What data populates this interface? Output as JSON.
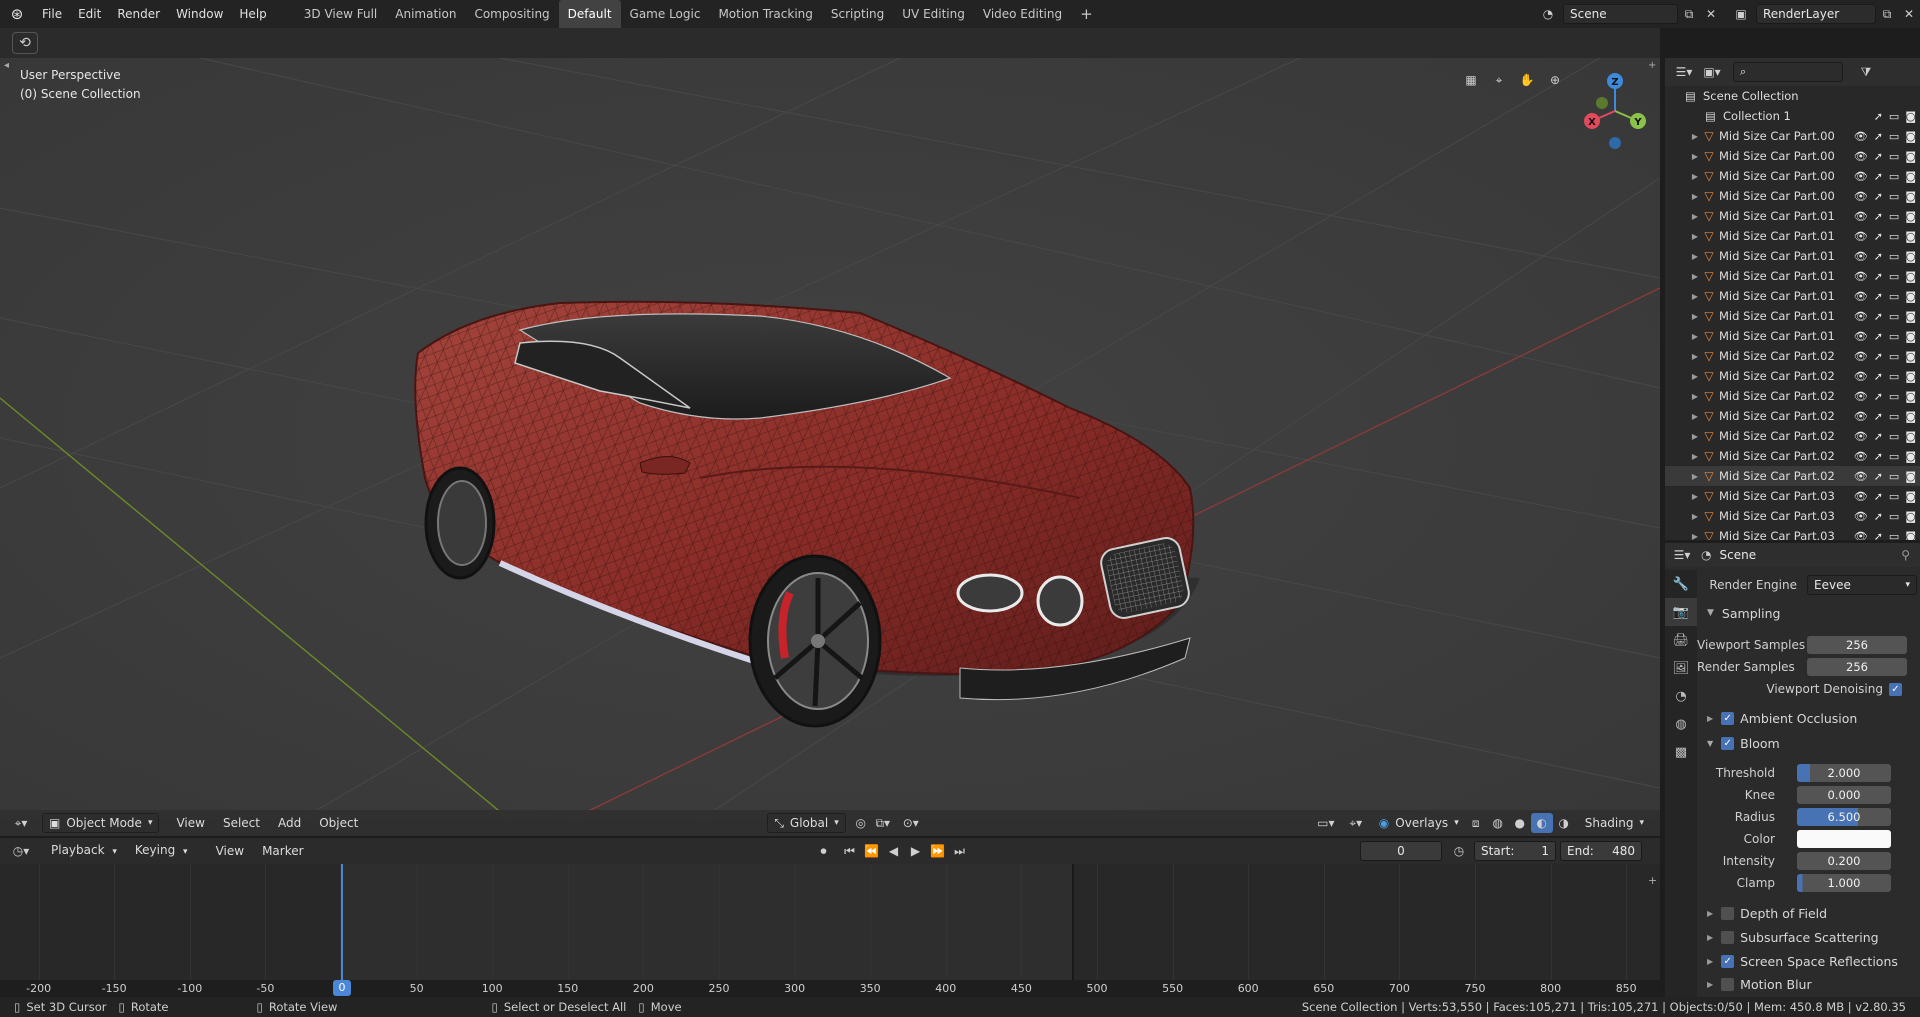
{
  "topbar": {
    "menus": [
      "File",
      "Edit",
      "Render",
      "Window",
      "Help"
    ],
    "workspaces": [
      "3D View Full",
      "Animation",
      "Compositing",
      "Default",
      "Game Logic",
      "Motion Tracking",
      "Scripting",
      "UV Editing",
      "Video Editing"
    ],
    "active_workspace": "Default",
    "add_workspace": "+",
    "scene_name": "Scene",
    "render_layer": "RenderLayer"
  },
  "viewport": {
    "perspective": "User Perspective",
    "collection": "(0) Scene Collection",
    "axes": {
      "x": "X",
      "y": "Y",
      "z": "Z"
    }
  },
  "viewport_header": {
    "mode": "Object Mode",
    "menus": [
      "View",
      "Select",
      "Add",
      "Object"
    ],
    "transform_orientation": "Global",
    "overlays": "Overlays",
    "shading": "Shading"
  },
  "timeline_header": {
    "menus": [
      "Playback",
      "Keying",
      "View",
      "Marker"
    ],
    "current_frame": "0",
    "start_label": "Start:",
    "start_value": "1",
    "end_label": "End:",
    "end_value": "480"
  },
  "timeline": {
    "ticks": [
      "-200",
      "-150",
      "-100",
      "-50",
      "0",
      "50",
      "100",
      "150",
      "200",
      "250",
      "300",
      "350",
      "400",
      "450",
      "500",
      "550",
      "600",
      "650",
      "700",
      "750",
      "800",
      "850"
    ],
    "current_frame_label": "0"
  },
  "outliner": {
    "root": "Scene Collection",
    "collection": "Collection 1",
    "items": [
      "Mid Size Car Part.00",
      "Mid Size Car Part.00",
      "Mid Size Car Part.00",
      "Mid Size Car Part.00",
      "Mid Size Car Part.01",
      "Mid Size Car Part.01",
      "Mid Size Car Part.01",
      "Mid Size Car Part.01",
      "Mid Size Car Part.01",
      "Mid Size Car Part.01",
      "Mid Size Car Part.01",
      "Mid Size Car Part.02",
      "Mid Size Car Part.02",
      "Mid Size Car Part.02",
      "Mid Size Car Part.02",
      "Mid Size Car Part.02",
      "Mid Size Car Part.02",
      "Mid Size Car Part.02",
      "Mid Size Car Part.03",
      "Mid Size Car Part.03",
      "Mid Size Car Part.03"
    ]
  },
  "properties": {
    "context": "Scene",
    "render_engine_label": "Render Engine",
    "render_engine": "Eevee",
    "sampling": "Sampling",
    "viewport_samples_label": "Viewport Samples",
    "viewport_samples": "256",
    "render_samples_label": "Render Samples",
    "render_samples": "256",
    "viewport_denoising": "Viewport Denoising",
    "ambient_occlusion": "Ambient Occlusion",
    "bloom": "Bloom",
    "bloom_settings": {
      "threshold_label": "Threshold",
      "threshold": "2.000",
      "knee_label": "Knee",
      "knee": "0.000",
      "radius_label": "Radius",
      "radius": "6.500",
      "color_label": "Color",
      "intensity_label": "Intensity",
      "intensity": "0.200",
      "clamp_label": "Clamp",
      "clamp": "1.000"
    },
    "depth_of_field": "Depth of Field",
    "subsurface_scattering": "Subsurface Scattering",
    "screen_space_reflections": "Screen Space Reflections",
    "motion_blur": "Motion Blur"
  },
  "statusbar": {
    "set_cursor": "Set 3D Cursor",
    "rotate": "Rotate",
    "rotate_view": "Rotate View",
    "select": "Select or Deselect All",
    "move": "Move",
    "stats": "Scene Collection | Verts:53,550 | Faces:105,271 | Tris:105,271 | Objects:0/50 | Mem: 450.8 MB | v2.80.35"
  },
  "colors": {
    "accent": "#4772b3",
    "car_body": "#8a2a26",
    "mesh_icon": "#e8853a",
    "x_axis": "#e04a5c",
    "y_axis": "#8bc34a",
    "z_axis": "#3d8bdc"
  }
}
